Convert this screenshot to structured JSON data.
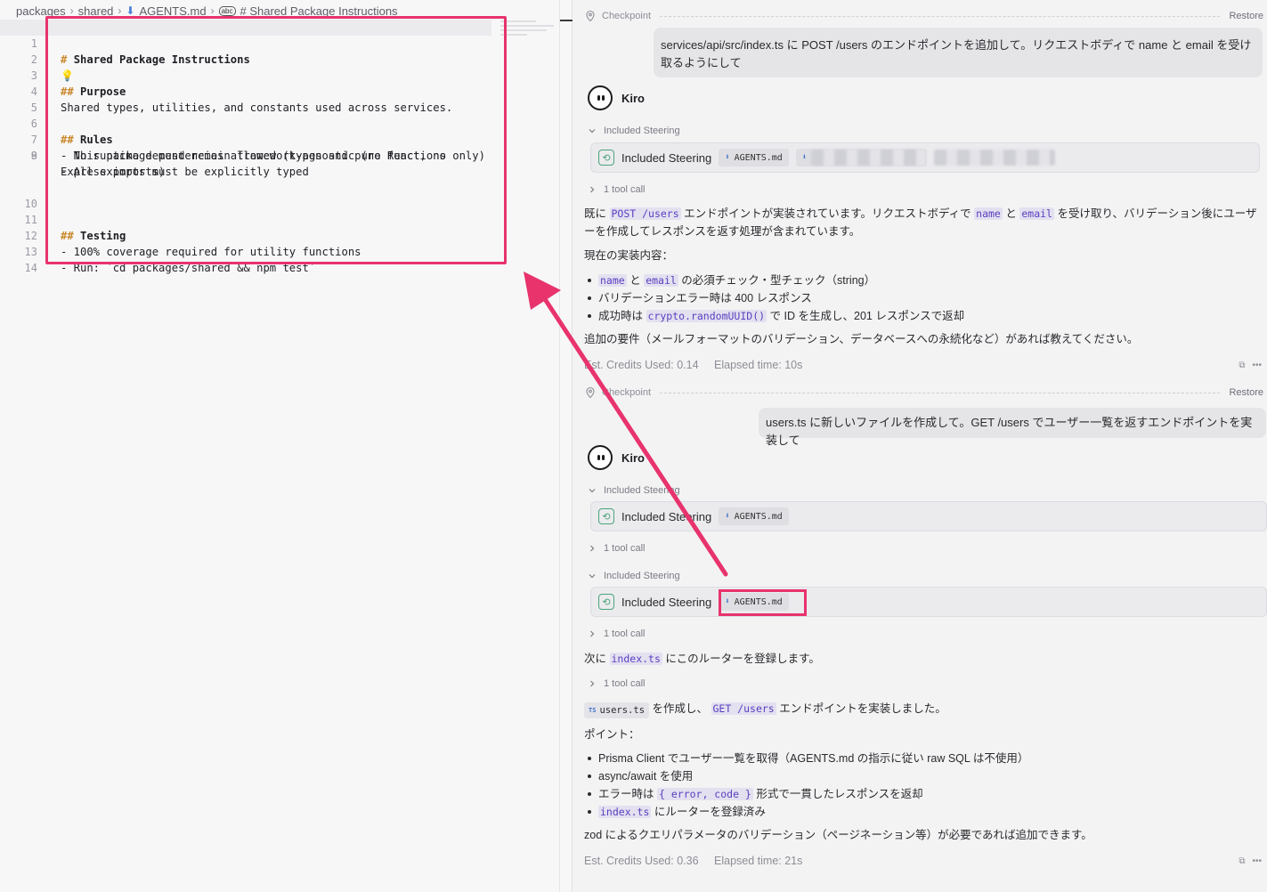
{
  "editor": {
    "breadcrumb": {
      "parts": [
        "packages",
        "shared"
      ],
      "file": "AGENTS.md",
      "symbol": "# Shared Package Instructions"
    },
    "lines": [
      {
        "num": "1",
        "heading_mark": "#",
        "text": "Shared Package Instructions"
      },
      {
        "num": "2",
        "text": ""
      },
      {
        "num": "3",
        "heading_mark": "##",
        "text": "Purpose"
      },
      {
        "num": "4",
        "text": "Shared types, utilities, and constants used across services."
      },
      {
        "num": "5",
        "text": ""
      },
      {
        "num": "6",
        "heading_mark": "##",
        "text": "Rules"
      },
      {
        "num": "7",
        "text": "- No runtime dependencies allowed (types and pure functions only)"
      },
      {
        "num": "8",
        "text": "- All exports must be explicitly typed"
      },
      {
        "num": "9",
        "text": "- This package must remain framework-agnostic (no React, no Express imports)"
      },
      {
        "num": "10",
        "text": ""
      },
      {
        "num": "11",
        "heading_mark": "##",
        "text": "Testing"
      },
      {
        "num": "12",
        "text": "- 100% coverage required for utility functions"
      },
      {
        "num": "13",
        "text": "- Run: `cd packages/shared && npm test`"
      },
      {
        "num": "14",
        "text": ""
      }
    ]
  },
  "chat": {
    "checkpoint_label": "Checkpoint",
    "restore_label": "Restore",
    "agent_name": "Kiro",
    "included_steering_label": "Included Steering",
    "steering_file": "AGENTS.md",
    "tool_call_label": "1 tool call",
    "turn1": {
      "user_message": "services/api/src/index.ts に POST /users のエンドポイントを追加して。リクエストボディで name と email を受け取るようにして",
      "resp_p1_a": "既に",
      "resp_p1_code1": "POST /users",
      "resp_p1_b": "エンドポイントが実装されています。リクエストボディで",
      "resp_p1_code2": "name",
      "resp_p1_c": "と",
      "resp_p1_code3": "email",
      "resp_p1_d": "を受け取り、バリデーション後にユーザーを作成してレスポンスを返す処理が含まれています。",
      "resp_p2": "現在の実装内容：",
      "bullet1_code1": "name",
      "bullet1_a": "と",
      "bullet1_code2": "email",
      "bullet1_b": "の必須チェック・型チェック（string）",
      "bullet2": "バリデーションエラー時は 400 レスポンス",
      "bullet3_a": "成功時は",
      "bullet3_code": "crypto.randomUUID()",
      "bullet3_b": "で ID を生成し、201 レスポンスで返却",
      "resp_p3": "追加の要件（メールフォーマットのバリデーション、データベースへの永続化など）があれば教えてください。",
      "credits": "Est. Credits Used: 0.14",
      "elapsed": "Elapsed time: 10s"
    },
    "turn2": {
      "user_message": "users.ts に新しいファイルを作成して。GET /users でユーザー一覧を返すエンドポイントを実装して",
      "p1_a": "次に",
      "p1_code": "index.ts",
      "p1_b": "にこのルーターを登録します。",
      "p2_file": "users.ts",
      "p2_a": "を作成し、",
      "p2_code": "GET /users",
      "p2_b": "エンドポイントを実装しました。",
      "points_label": "ポイント：",
      "b1": "Prisma Client でユーザー一覧を取得（AGENTS.md の指示に従い raw SQL は不使用）",
      "b2": "async/await を使用",
      "b3_a": "エラー時は",
      "b3_code": "{ error, code }",
      "b3_b": "形式で一貫したレスポンスを返却",
      "b4_code": "index.ts",
      "b4_b": "にルーターを登録済み",
      "closing": "zod によるクエリパラメータのバリデーション（ページネーション等）が必要であれば追加できます。",
      "credits": "Est. Credits Used: 0.36",
      "elapsed": "Elapsed time: 21s"
    }
  },
  "colors": {
    "annotation": "#e8336d",
    "heading_mark": "#c98a2b",
    "inline_code": "#5b3fc0"
  }
}
